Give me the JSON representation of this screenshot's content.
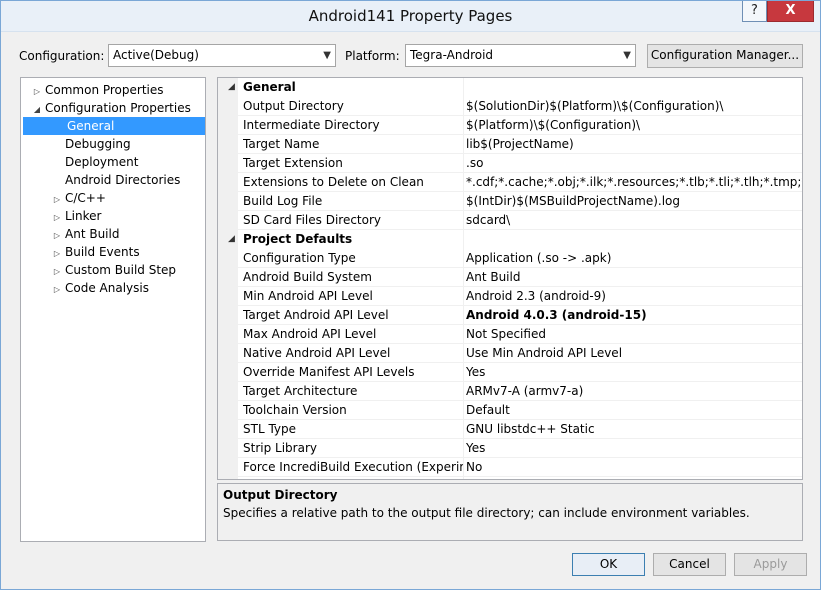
{
  "window": {
    "title": "Android141 Property Pages",
    "help_label": "?",
    "close_label": "X"
  },
  "toolbar": {
    "configuration_label": "Configuration:",
    "configuration_value": "Active(Debug)",
    "platform_label": "Platform:",
    "platform_value": "Tegra-Android",
    "config_manager_label": "Configuration Manager..."
  },
  "tree": {
    "items": [
      {
        "label": "Common Properties",
        "expander": "collapsed"
      },
      {
        "label": "Configuration Properties",
        "expander": "expanded"
      },
      {
        "label": "General",
        "expander": "none",
        "selected": true
      },
      {
        "label": "Debugging",
        "expander": "none"
      },
      {
        "label": "Deployment",
        "expander": "none"
      },
      {
        "label": "Android Directories",
        "expander": "none"
      },
      {
        "label": "C/C++",
        "expander": "collapsed"
      },
      {
        "label": "Linker",
        "expander": "collapsed"
      },
      {
        "label": "Ant Build",
        "expander": "collapsed"
      },
      {
        "label": "Build Events",
        "expander": "collapsed"
      },
      {
        "label": "Custom Build Step",
        "expander": "collapsed"
      },
      {
        "label": "Code Analysis",
        "expander": "collapsed"
      }
    ]
  },
  "grid": {
    "categories": [
      {
        "name": "General",
        "properties": [
          {
            "name": "Output Directory",
            "value": "$(SolutionDir)$(Platform)\\$(Configuration)\\"
          },
          {
            "name": "Intermediate Directory",
            "value": "$(Platform)\\$(Configuration)\\"
          },
          {
            "name": "Target Name",
            "value": "lib$(ProjectName)"
          },
          {
            "name": "Target Extension",
            "value": ".so"
          },
          {
            "name": "Extensions to Delete on Clean",
            "value": "*.cdf;*.cache;*.obj;*.ilk;*.resources;*.tlb;*.tli;*.tlh;*.tmp;*.rsp;*.pgc"
          },
          {
            "name": "Build Log File",
            "value": "$(IntDir)$(MSBuildProjectName).log"
          },
          {
            "name": "SD Card Files Directory",
            "value": "sdcard\\"
          }
        ]
      },
      {
        "name": "Project Defaults",
        "properties": [
          {
            "name": "Configuration Type",
            "value": "Application (.so -> .apk)"
          },
          {
            "name": "Android Build System",
            "value": "Ant Build"
          },
          {
            "name": "Min Android API Level",
            "value": "Android 2.3 (android-9)"
          },
          {
            "name": "Target Android API Level",
            "value": "Android 4.0.3 (android-15)",
            "bold": true
          },
          {
            "name": "Max Android API Level",
            "value": "Not Specified"
          },
          {
            "name": "Native Android API Level",
            "value": "Use Min Android API Level"
          },
          {
            "name": "Override Manifest API Levels",
            "value": "Yes"
          },
          {
            "name": "Target Architecture",
            "value": "ARMv7-A (armv7-a)"
          },
          {
            "name": "Toolchain Version",
            "value": "Default"
          },
          {
            "name": "STL Type",
            "value": "GNU libstdc++ Static"
          },
          {
            "name": "Strip Library",
            "value": "Yes"
          },
          {
            "name": "Force IncrediBuild Execution (Experimental)",
            "value": "No"
          }
        ]
      }
    ]
  },
  "description": {
    "title": "Output Directory",
    "text": "Specifies a relative path to the output file directory; can include environment variables."
  },
  "footer": {
    "ok_label": "OK",
    "cancel_label": "Cancel",
    "apply_label": "Apply"
  },
  "icons": {
    "expanded": "expanded-triangle-icon",
    "collapsed": "collapsed-triangle-icon",
    "dropdown": "chevron-down-icon"
  }
}
